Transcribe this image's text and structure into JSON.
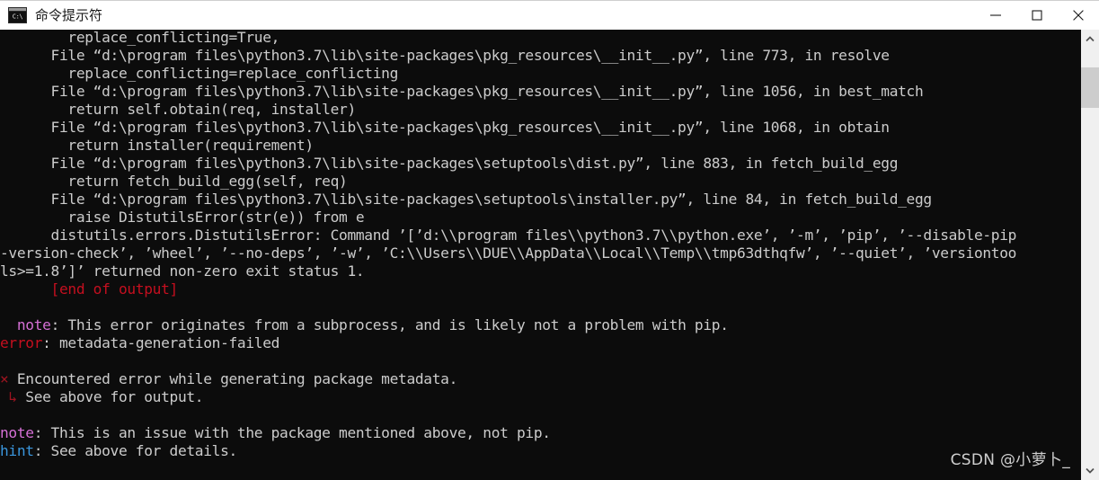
{
  "window": {
    "title": "命令提示符",
    "icon": "cmd-icon",
    "icon_text": "C:\\",
    "controls": {
      "minimize": "minimize-button",
      "maximize": "maximize-button",
      "close": "close-button"
    }
  },
  "theme": {
    "titlebar_bg": "#ffffff",
    "titlebar_fg": "#1a1a1a",
    "terminal_bg": "#0c0c0c",
    "terminal_fg": "#cccccc",
    "red": "#c50f1f",
    "dark_red": "#9e1420",
    "magenta": "#d670d6",
    "cyan": "#3a96dd",
    "scrollbar_track": "#f0f0f0",
    "scrollbar_thumb": "#cdcdcd"
  },
  "scrollbar": {
    "up_arrow": "chevron-up-icon",
    "down_arrow": "chevron-down-icon",
    "thumb_position_percent": 5
  },
  "watermark": {
    "text": "CSDN @小萝卜_"
  },
  "console": {
    "lines": [
      {
        "segments": [
          {
            "text": "        replace_conflicting=True,",
            "color": "default"
          }
        ]
      },
      {
        "segments": [
          {
            "text": "      File “d:\\program files\\python3.7\\lib\\site-packages\\pkg_resources\\__init__.py”, line 773, in resolve",
            "color": "default"
          }
        ]
      },
      {
        "segments": [
          {
            "text": "        replace_conflicting=replace_conflicting",
            "color": "default"
          }
        ]
      },
      {
        "segments": [
          {
            "text": "      File “d:\\program files\\python3.7\\lib\\site-packages\\pkg_resources\\__init__.py”, line 1056, in best_match",
            "color": "default"
          }
        ]
      },
      {
        "segments": [
          {
            "text": "        return self.obtain(req, installer)",
            "color": "default"
          }
        ]
      },
      {
        "segments": [
          {
            "text": "      File “d:\\program files\\python3.7\\lib\\site-packages\\pkg_resources\\__init__.py”, line 1068, in obtain",
            "color": "default"
          }
        ]
      },
      {
        "segments": [
          {
            "text": "        return installer(requirement)",
            "color": "default"
          }
        ]
      },
      {
        "segments": [
          {
            "text": "      File “d:\\program files\\python3.7\\lib\\site-packages\\setuptools\\dist.py”, line 883, in fetch_build_egg",
            "color": "default"
          }
        ]
      },
      {
        "segments": [
          {
            "text": "        return fetch_build_egg(self, req)",
            "color": "default"
          }
        ]
      },
      {
        "segments": [
          {
            "text": "      File “d:\\program files\\python3.7\\lib\\site-packages\\setuptools\\installer.py”, line 84, in fetch_build_egg",
            "color": "default"
          }
        ]
      },
      {
        "segments": [
          {
            "text": "        raise DistutilsError(str(e)) from e",
            "color": "default"
          }
        ]
      },
      {
        "segments": [
          {
            "text": "      distutils.errors.DistutilsError: Command ’[’d:\\\\program files\\\\python3.7\\\\python.exe’, ’-m’, ’pip’, ’--disable-pip",
            "color": "default"
          }
        ]
      },
      {
        "segments": [
          {
            "text": "-version-check’, ’wheel’, ’--no-deps’, ’-w’, ’C:\\\\Users\\\\DUE\\\\AppData\\\\Local\\\\Temp\\\\tmp63dthqfw’, ’--quiet’, ’versiontoo",
            "color": "default"
          }
        ]
      },
      {
        "segments": [
          {
            "text": "ls>=1.8’]’ returned non-zero exit status 1.",
            "color": "default"
          }
        ]
      },
      {
        "segments": [
          {
            "text": "      [end of output]",
            "color": "red"
          }
        ]
      },
      {
        "segments": [
          {
            "text": "",
            "color": "default"
          }
        ]
      },
      {
        "segments": [
          {
            "text": "  ",
            "color": "default"
          },
          {
            "text": "note",
            "color": "magenta"
          },
          {
            "text": ": This error originates from a subprocess, and is likely not a problem with pip.",
            "color": "default"
          }
        ]
      },
      {
        "segments": [
          {
            "text": "error",
            "color": "red"
          },
          {
            "text": ": metadata-generation-failed",
            "color": "default"
          }
        ]
      },
      {
        "segments": [
          {
            "text": "",
            "color": "default"
          }
        ]
      },
      {
        "segments": [
          {
            "text": "×",
            "color": "darkred"
          },
          {
            "text": " Encountered error while generating package metadata.",
            "color": "default"
          }
        ]
      },
      {
        "segments": [
          {
            "text": " ↳",
            "color": "darkred"
          },
          {
            "text": " See above for output.",
            "color": "default"
          }
        ]
      },
      {
        "segments": [
          {
            "text": "",
            "color": "default"
          }
        ]
      },
      {
        "segments": [
          {
            "text": "note",
            "color": "magenta"
          },
          {
            "text": ": This is an issue with the package mentioned above, not pip.",
            "color": "default"
          }
        ]
      },
      {
        "segments": [
          {
            "text": "hint",
            "color": "cyan"
          },
          {
            "text": ": See above for details.",
            "color": "default"
          }
        ]
      }
    ]
  }
}
